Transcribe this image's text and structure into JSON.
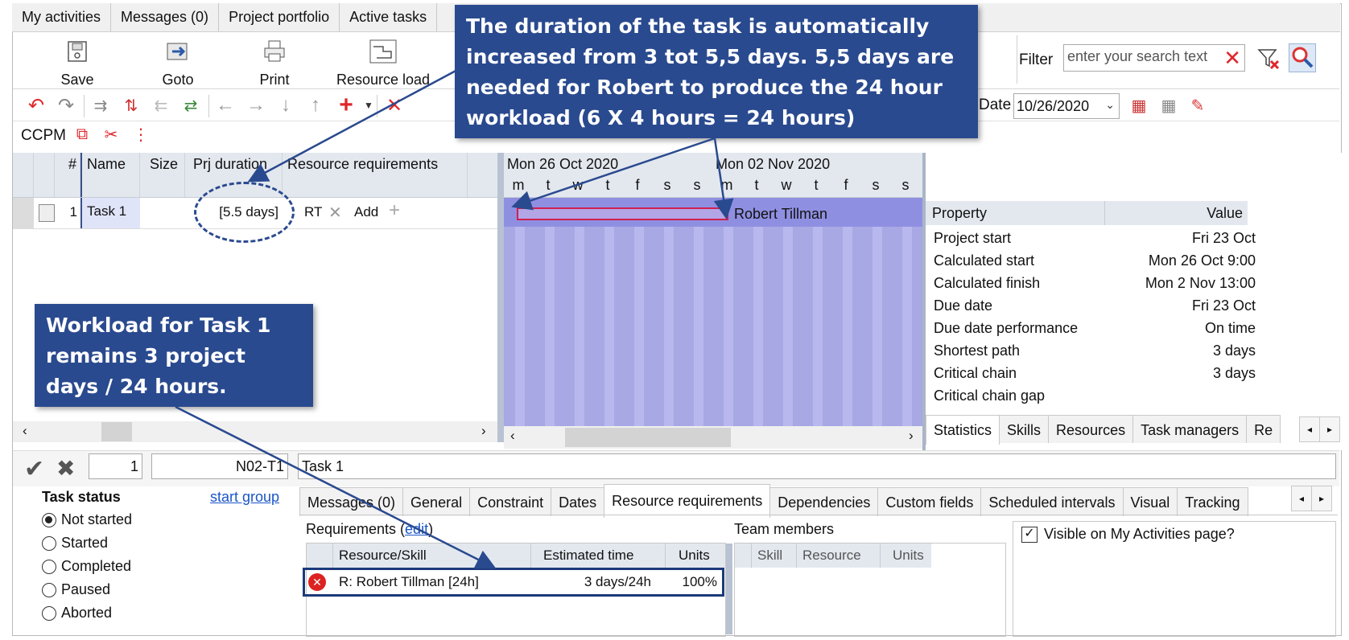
{
  "top_tabs": [
    "My activities",
    "Messages (0)",
    "Project portfolio",
    "Active tasks"
  ],
  "ribbon": {
    "save": "Save",
    "goto": "Goto",
    "print": "Print",
    "resource_load": "Resource load",
    "cut_label": "Re"
  },
  "filter": {
    "label": "Filter",
    "placeholder": "enter your search text"
  },
  "date_filter": {
    "label": "Date",
    "value": "10/26/2020"
  },
  "ccpm_label": "CCPM",
  "grid": {
    "columns": [
      "#",
      "Name",
      "Size",
      "Prj duration",
      "Resource requirements"
    ],
    "row": {
      "num": "1",
      "name": "Task 1",
      "duration": "[5.5 days]",
      "res_code": "RT",
      "add": "Add"
    }
  },
  "gantt": {
    "week1": "Mon 26 Oct 2020",
    "week2": "Mon 02 Nov 2020",
    "days": [
      "m",
      "t",
      "w",
      "t",
      "f",
      "s",
      "s",
      "m",
      "t",
      "w",
      "t",
      "f",
      "s",
      "s"
    ],
    "bar_label": "Robert Tillman"
  },
  "properties": {
    "header_property": "Property",
    "header_value": "Value",
    "rows": [
      {
        "k": "Project start",
        "v": "Fri 23 Oct"
      },
      {
        "k": "Calculated start",
        "v": "Mon 26 Oct 9:00"
      },
      {
        "k": "Calculated finish",
        "v": "Mon 2 Nov 13:00"
      },
      {
        "k": "Due date",
        "v": "Fri 23 Oct"
      },
      {
        "k": "Due date performance",
        "v": "On time"
      },
      {
        "k": "Shortest path",
        "v": "3 days"
      },
      {
        "k": "Critical chain",
        "v": "3 days"
      },
      {
        "k": "Critical chain gap",
        "v": ""
      }
    ],
    "tabs": [
      "Statistics",
      "Skills",
      "Resources",
      "Task managers",
      "Re"
    ]
  },
  "editor": {
    "num": "1",
    "code": "N02-T1",
    "name": "Task 1"
  },
  "task_status": {
    "title": "Task status",
    "start_group": "start group",
    "options": [
      "Not started",
      "Started",
      "Completed",
      "Paused",
      "Aborted"
    ]
  },
  "bottom_tabs": [
    "Messages (0)",
    "General",
    "Constraint",
    "Dates",
    "Resource requirements",
    "Dependencies",
    "Custom fields",
    "Scheduled intervals",
    "Visual",
    "Tracking"
  ],
  "requirements": {
    "title": "Requirements (",
    "edit": "edit",
    "close": ")",
    "columns": [
      "Resource/Skill",
      "Estimated time",
      "Units"
    ],
    "row": {
      "resource": "R: Robert Tillman [24h]",
      "time": "3 days/24h",
      "units": "100%"
    }
  },
  "team": {
    "title": "Team members",
    "columns": [
      "Skill",
      "Resource",
      "Units"
    ]
  },
  "visible_checkbox": "Visible on My Activities page?",
  "callouts": {
    "top": "The duration of the task is automatically increased from 3 tot 5,5 days.  5,5 days are needed for Robert to produce the 24 hour workload (6 X 4 hours = 24 hours)",
    "left": "Workload for Task 1 remains 3 project days / 24 hours."
  },
  "colors": {
    "callout": "#2a4a8f",
    "gantt_bg": "#a8a8e4",
    "gantt_stripe": "#b8b8ee",
    "accent_red": "#e0262a",
    "link": "#1a55c8"
  }
}
